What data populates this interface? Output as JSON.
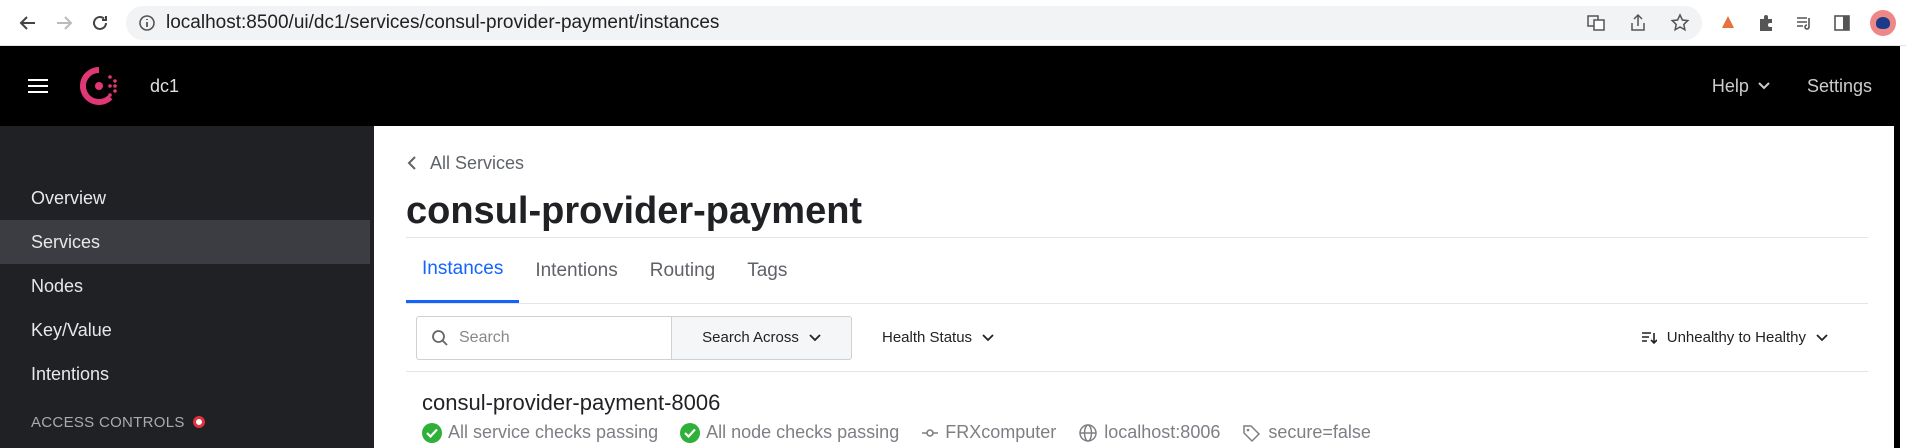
{
  "browser": {
    "url": "localhost:8500/ui/dc1/services/consul-provider-payment/instances"
  },
  "header": {
    "datacenter": "dc1",
    "help_label": "Help",
    "settings_label": "Settings"
  },
  "sidebar": {
    "items": [
      {
        "label": "Overview"
      },
      {
        "label": "Services"
      },
      {
        "label": "Nodes"
      },
      {
        "label": "Key/Value"
      },
      {
        "label": "Intentions"
      }
    ],
    "section_label": "ACCESS CONTROLS"
  },
  "main": {
    "breadcrumb": "All Services",
    "title": "consul-provider-payment",
    "tabs": [
      {
        "label": "Instances"
      },
      {
        "label": "Intentions"
      },
      {
        "label": "Routing"
      },
      {
        "label": "Tags"
      }
    ],
    "toolbar": {
      "search_placeholder": "Search",
      "search_across_label": "Search Across",
      "health_status_label": "Health Status",
      "sort_label": "Unhealthy to Healthy"
    },
    "instance": {
      "name": "consul-provider-payment-8006",
      "service_checks": "All service checks passing",
      "node_checks": "All node checks passing",
      "node": "FRXcomputer",
      "address": "localhost:8006",
      "tag": "secure=false"
    }
  },
  "colors": {
    "accent": "#1563ff",
    "consul_brand": "#e03875",
    "passing": "#2eb039"
  }
}
